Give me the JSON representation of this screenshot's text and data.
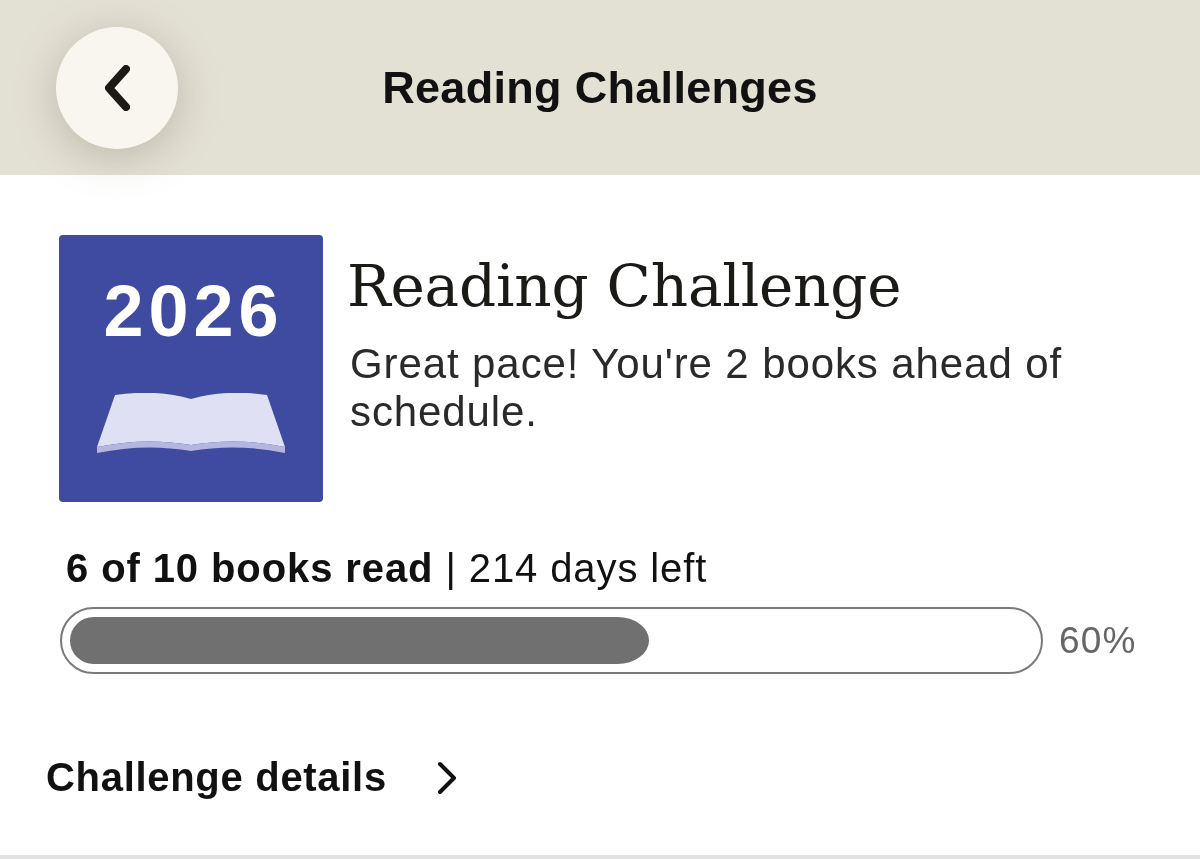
{
  "header": {
    "title": "Reading Challenges"
  },
  "challenge": {
    "cover_year": "2026",
    "title": "Reading Challenge",
    "message": "Great pace! You're 2 books ahead of schedule.",
    "progress_text": "**6 of 10 books read** | 214 days left",
    "progress": {
      "level": 0.6,
      "percent": "60%"
    }
  },
  "details_link": {
    "label": "Challenge details"
  }
}
